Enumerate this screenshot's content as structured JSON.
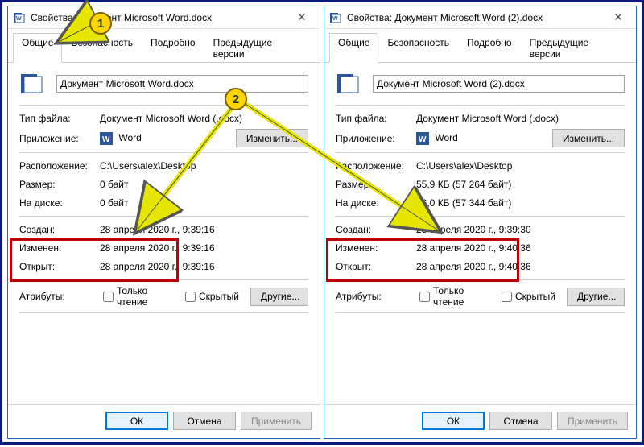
{
  "annotations": {
    "callout1": "1",
    "callout2": "2"
  },
  "dialogs": [
    {
      "title": "Свойства: Документ Microsoft Word.docx",
      "filename": "Документ Microsoft Word.docx",
      "tabs": [
        "Общие",
        "Безопасность",
        "Подробно",
        "Предыдущие версии"
      ],
      "labels": {
        "filetype": "Тип файла:",
        "app": "Приложение:",
        "location": "Расположение:",
        "size": "Размер:",
        "ondisk": "На диске:",
        "created": "Создан:",
        "modified": "Изменен:",
        "opened": "Открыт:",
        "attributes": "Атрибуты:"
      },
      "values": {
        "filetype": "Документ Microsoft Word (.docx)",
        "app": "Word",
        "location": "C:\\Users\\alex\\Desktop",
        "size": "0 байт",
        "ondisk": "0 байт",
        "created": "28 апреля 2020 г., 9:39:16",
        "modified": "28 апреля 2020 г., 9:39:16",
        "opened": "28 апреля 2020 г., 9:39:16"
      },
      "buttons": {
        "change": "Изменить...",
        "other": "Другие...",
        "ok": "ОК",
        "cancel": "Отмена",
        "apply": "Применить"
      },
      "checkboxes": {
        "readonly": "Только чтение",
        "hidden": "Скрытый"
      }
    },
    {
      "title": "Свойства: Документ Microsoft Word (2).docx",
      "filename": "Документ Microsoft Word (2).docx",
      "tabs": [
        "Общие",
        "Безопасность",
        "Подробно",
        "Предыдущие версии"
      ],
      "labels": {
        "filetype": "Тип файла:",
        "app": "Приложение:",
        "location": "Расположение:",
        "size": "Размер:",
        "ondisk": "На диске:",
        "created": "Создан:",
        "modified": "Изменен:",
        "opened": "Открыт:",
        "attributes": "Атрибуты:"
      },
      "values": {
        "filetype": "Документ Microsoft Word (.docx)",
        "app": "Word",
        "location": "C:\\Users\\alex\\Desktop",
        "size": "55,9 КБ (57 264 байт)",
        "ondisk": "56,0 КБ (57 344 байт)",
        "created": "28 апреля 2020 г., 9:39:30",
        "modified": "28 апреля 2020 г., 9:40:36",
        "opened": "28 апреля 2020 г., 9:40:36"
      },
      "buttons": {
        "change": "Изменить...",
        "other": "Другие...",
        "ok": "ОК",
        "cancel": "Отмена",
        "apply": "Применить"
      },
      "checkboxes": {
        "readonly": "Только чтение",
        "hidden": "Скрытый"
      }
    }
  ]
}
